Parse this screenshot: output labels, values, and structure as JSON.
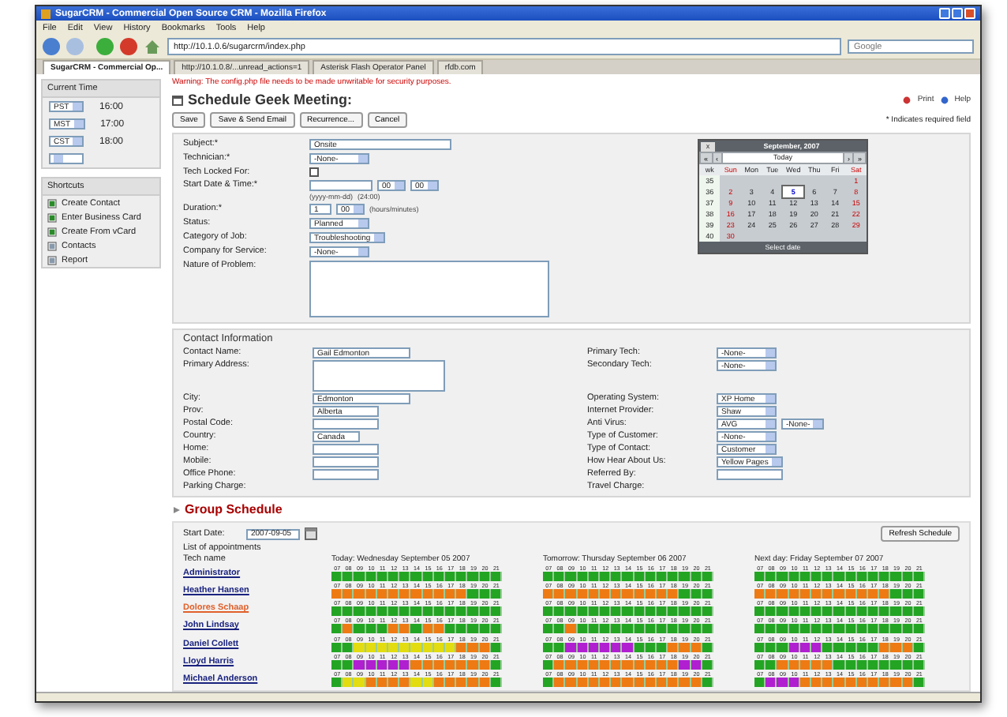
{
  "window": {
    "title": "SugarCRM - Commercial Open Source CRM - Mozilla Firefox"
  },
  "menu": [
    "File",
    "Edit",
    "View",
    "History",
    "Bookmarks",
    "Tools",
    "Help"
  ],
  "address_bar": {
    "value": "http://10.1.0.6/sugarcrm/index.php"
  },
  "search": {
    "placeholder": "Google"
  },
  "tabs": [
    {
      "label": "SugarCRM - Commercial Op...",
      "selected": true
    },
    {
      "label": "http://10.1.0.8/...unread_actions=1",
      "selected": false
    },
    {
      "label": "Asterisk Flash Operator Panel",
      "selected": false
    },
    {
      "label": "rfdb.com",
      "selected": false
    }
  ],
  "sidebar": {
    "current_time": {
      "title": "Current Time",
      "rows": [
        {
          "zone": "PST",
          "time": "16:00"
        },
        {
          "zone": "MST",
          "time": "17:00"
        },
        {
          "zone": "CST",
          "time": "18:00"
        }
      ]
    },
    "shortcuts": {
      "title": "Shortcuts",
      "items": [
        {
          "label": "Create Contact"
        },
        {
          "label": "Enter Business Card"
        },
        {
          "label": "Create From vCard"
        },
        {
          "label": "Contacts"
        },
        {
          "label": "Report"
        }
      ]
    }
  },
  "warning": "Warning: The config.php file needs to be made unwritable for security purposes.",
  "page_title": "Schedule Geek Meeting:",
  "header_links": [
    "Print",
    "Help"
  ],
  "buttons": [
    "Save",
    "Save & Send Email",
    "Recurrence...",
    "Cancel"
  ],
  "required_note": "* Indicates required field",
  "form": {
    "fields": [
      {
        "label": "Subject:*",
        "kind": "text",
        "value": "Onsite"
      },
      {
        "label": "Technician:*",
        "kind": "select",
        "value": "-None-"
      },
      {
        "label": "Tech Locked For:",
        "kind": "checkbox",
        "checked": false
      },
      {
        "label": "Start Date & Time:*",
        "kind": "datetime",
        "selects": [
          "00",
          "00"
        ],
        "hints": [
          "(yyyy-mm-dd)",
          "(24:00)"
        ]
      },
      {
        "label": "Duration:*",
        "kind": "duration",
        "value": "1",
        "selects": [
          "00"
        ],
        "hints": [
          "(hours/minutes)"
        ]
      },
      {
        "label": "Status:",
        "kind": "select",
        "value": "Planned"
      },
      {
        "label": "Category of Job:",
        "kind": "select",
        "value": "Troubleshooting"
      },
      {
        "label": "Company for Service:",
        "kind": "select",
        "value": "-None-"
      },
      {
        "label": "Nature of Problem:",
        "kind": "textarea"
      }
    ],
    "calendar": {
      "title": "September, 2007",
      "today": "Today",
      "nav": [
        "«",
        "‹",
        "›",
        "»"
      ],
      "close": "x",
      "weekdays": [
        "wk",
        "Sun",
        "Mon",
        "Tue",
        "Wed",
        "Thu",
        "Fri",
        "Sat"
      ],
      "footer": "Select date",
      "weeks": [
        {
          "week": "35",
          "days": [
            {
              "day": "1",
              "selected": false
            }
          ]
        },
        {
          "week": "36",
          "days": [
            {
              "day": "2",
              "selected": false
            },
            {
              "day": "3",
              "selected": false
            },
            {
              "day": "4",
              "selected": false
            },
            {
              "day": "5",
              "selected": true
            },
            {
              "day": "6",
              "selected": false
            },
            {
              "day": "7",
              "selected": false
            },
            {
              "day": "8",
              "selected": false
            }
          ]
        },
        {
          "week": "37",
          "days": [
            {
              "day": "9",
              "selected": false
            },
            {
              "day": "10",
              "selected": false
            },
            {
              "day": "11",
              "selected": false
            },
            {
              "day": "12",
              "selected": false
            },
            {
              "day": "13",
              "selected": false
            },
            {
              "day": "14",
              "selected": false
            },
            {
              "day": "15",
              "selected": false
            }
          ]
        },
        {
          "week": "38",
          "days": [
            {
              "day": "16",
              "selected": false
            },
            {
              "day": "17",
              "selected": false
            },
            {
              "day": "18",
              "selected": false
            },
            {
              "day": "19",
              "selected": false
            },
            {
              "day": "20",
              "selected": false
            },
            {
              "day": "21",
              "selected": false
            },
            {
              "day": "22",
              "selected": false
            }
          ]
        },
        {
          "week": "39",
          "days": [
            {
              "day": "23",
              "selected": false
            },
            {
              "day": "24",
              "selected": false
            },
            {
              "day": "25",
              "selected": false
            },
            {
              "day": "26",
              "selected": false
            },
            {
              "day": "27",
              "selected": false
            },
            {
              "day": "28",
              "selected": false
            },
            {
              "day": "29",
              "selected": false
            }
          ]
        },
        {
          "week": "40",
          "days": [
            {
              "day": "30",
              "selected": false
            }
          ]
        }
      ]
    }
  },
  "contact": {
    "title": "Contact Information",
    "left": [
      {
        "label": "Contact Name:",
        "kind": "text",
        "value": "Gail Edmonton"
      },
      {
        "label": "Primary Address:",
        "kind": "textarea"
      },
      {
        "label": "City:",
        "kind": "text",
        "value": "Edmonton"
      },
      {
        "label": "Prov:",
        "kind": "short",
        "value": "Alberta"
      },
      {
        "label": "Postal Code:",
        "kind": "short"
      },
      {
        "label": "Country:",
        "kind": "tiny",
        "value": "Canada"
      },
      {
        "label": "Home:",
        "kind": "short"
      },
      {
        "label": "Mobile:",
        "kind": "short"
      },
      {
        "label": "Office Phone:",
        "kind": "short"
      },
      {
        "label": "Parking Charge:",
        "kind": "none"
      }
    ],
    "right": [
      [
        {
          "label": "Primary Tech:",
          "kind": "select",
          "value": "-None-"
        },
        {
          "label": "Secondary Tech:",
          "kind": "select",
          "value": "-None-"
        }
      ],
      [
        {
          "label": "Operating System:",
          "kind": "select",
          "value": "XP Home"
        },
        {
          "label": "Internet Provider:",
          "kind": "select",
          "value": "Shaw"
        },
        {
          "label": "Anti Virus:",
          "kind": "select2",
          "value": "AVG",
          "value2": "-None-"
        },
        {
          "label": "Type of Customer:",
          "kind": "select",
          "value": "-None-"
        },
        {
          "label": "Type of Contact:",
          "kind": "select",
          "value": "Customer"
        },
        {
          "label": "How Hear About Us:",
          "kind": "select",
          "value": "Yellow Pages"
        },
        {
          "label": "Referred By:",
          "kind": "short"
        },
        {
          "label": "Travel Charge:",
          "kind": "none"
        }
      ]
    ]
  },
  "schedule": {
    "title": "Group Schedule",
    "start_label": "Start Date:",
    "start_value": "2007-09-05",
    "refresh": "Refresh Schedule",
    "list_label": "List of appointments",
    "tech_header": "Tech name",
    "days": [
      "Today: Wednesday September 05 2007",
      "Tomorrow: Thursday September 06 2007",
      "Next day: Friday September 07 2007"
    ],
    "rows": [
      {
        "name": "Administrator",
        "color": "#1a237e",
        "days": [
          [
            {
              "hour": "07",
              "color": "#23a523"
            },
            {
              "hour": "08",
              "color": "#23a523"
            },
            {
              "hour": "09",
              "color": "#23a523"
            },
            {
              "hour": "10",
              "color": "#23a523"
            },
            {
              "hour": "11",
              "color": "#23a523"
            },
            {
              "hour": "12",
              "color": "#23a523"
            },
            {
              "hour": "13",
              "color": "#23a523"
            },
            {
              "hour": "14",
              "color": "#23a523"
            },
            {
              "hour": "15",
              "color": "#23a523"
            },
            {
              "hour": "16",
              "color": "#23a523"
            },
            {
              "hour": "17",
              "color": "#23a523"
            },
            {
              "hour": "18",
              "color": "#23a523"
            },
            {
              "hour": "19",
              "color": "#23a523"
            },
            {
              "hour": "20",
              "color": "#23a523"
            },
            {
              "hour": "21",
              "color": "#23a523"
            }
          ],
          [
            {
              "hour": "07",
              "color": "#23a523"
            },
            {
              "hour": "08",
              "color": "#23a523"
            },
            {
              "hour": "09",
              "color": "#23a523"
            },
            {
              "hour": "10",
              "color": "#23a523"
            },
            {
              "hour": "11",
              "color": "#23a523"
            },
            {
              "hour": "12",
              "color": "#23a523"
            },
            {
              "hour": "13",
              "color": "#23a523"
            },
            {
              "hour": "14",
              "color": "#23a523"
            },
            {
              "hour": "15",
              "color": "#23a523"
            },
            {
              "hour": "16",
              "color": "#23a523"
            },
            {
              "hour": "17",
              "color": "#23a523"
            },
            {
              "hour": "18",
              "color": "#23a523"
            },
            {
              "hour": "19",
              "color": "#23a523"
            },
            {
              "hour": "20",
              "color": "#23a523"
            },
            {
              "hour": "21",
              "color": "#23a523"
            }
          ],
          [
            {
              "hour": "07",
              "color": "#23a523"
            },
            {
              "hour": "08",
              "color": "#23a523"
            },
            {
              "hour": "09",
              "color": "#23a523"
            },
            {
              "hour": "10",
              "color": "#23a523"
            },
            {
              "hour": "11",
              "color": "#23a523"
            },
            {
              "hour": "12",
              "color": "#23a523"
            },
            {
              "hour": "13",
              "color": "#23a523"
            },
            {
              "hour": "14",
              "color": "#23a523"
            },
            {
              "hour": "15",
              "color": "#23a523"
            },
            {
              "hour": "16",
              "color": "#23a523"
            },
            {
              "hour": "17",
              "color": "#23a523"
            },
            {
              "hour": "18",
              "color": "#23a523"
            },
            {
              "hour": "19",
              "color": "#23a523"
            },
            {
              "hour": "20",
              "color": "#23a523"
            },
            {
              "hour": "21",
              "color": "#23a523"
            }
          ]
        ]
      },
      {
        "name": "Heather Hansen",
        "color": "#1a237e",
        "days": [
          [
            {
              "hour": "07",
              "color": "#ee7a14"
            },
            {
              "hour": "08",
              "color": "#ee7a14"
            },
            {
              "hour": "09",
              "color": "#ee7a14"
            },
            {
              "hour": "10",
              "color": "#ee7a14"
            },
            {
              "hour": "11",
              "color": "#ee7a14"
            },
            {
              "hour": "12",
              "color": "#ee7a14"
            },
            {
              "hour": "13",
              "color": "#ee7a14"
            },
            {
              "hour": "14",
              "color": "#ee7a14"
            },
            {
              "hour": "15",
              "color": "#ee7a14"
            },
            {
              "hour": "16",
              "color": "#ee7a14"
            },
            {
              "hour": "17",
              "color": "#ee7a14"
            },
            {
              "hour": "18",
              "color": "#ee7a14"
            },
            {
              "hour": "19",
              "color": "#23a523"
            },
            {
              "hour": "20",
              "color": "#23a523"
            },
            {
              "hour": "21",
              "color": "#23a523"
            }
          ],
          [
            {
              "hour": "07",
              "color": "#ee7a14"
            },
            {
              "hour": "08",
              "color": "#ee7a14"
            },
            {
              "hour": "09",
              "color": "#ee7a14"
            },
            {
              "hour": "10",
              "color": "#ee7a14"
            },
            {
              "hour": "11",
              "color": "#ee7a14"
            },
            {
              "hour": "12",
              "color": "#ee7a14"
            },
            {
              "hour": "13",
              "color": "#ee7a14"
            },
            {
              "hour": "14",
              "color": "#ee7a14"
            },
            {
              "hour": "15",
              "color": "#ee7a14"
            },
            {
              "hour": "16",
              "color": "#ee7a14"
            },
            {
              "hour": "17",
              "color": "#ee7a14"
            },
            {
              "hour": "18",
              "color": "#ee7a14"
            },
            {
              "hour": "19",
              "color": "#23a523"
            },
            {
              "hour": "20",
              "color": "#23a523"
            },
            {
              "hour": "21",
              "color": "#23a523"
            }
          ],
          [
            {
              "hour": "07",
              "color": "#ee7a14"
            },
            {
              "hour": "08",
              "color": "#ee7a14"
            },
            {
              "hour": "09",
              "color": "#ee7a14"
            },
            {
              "hour": "10",
              "color": "#ee7a14"
            },
            {
              "hour": "11",
              "color": "#ee7a14"
            },
            {
              "hour": "12",
              "color": "#ee7a14"
            },
            {
              "hour": "13",
              "color": "#ee7a14"
            },
            {
              "hour": "14",
              "color": "#ee7a14"
            },
            {
              "hour": "15",
              "color": "#ee7a14"
            },
            {
              "hour": "16",
              "color": "#ee7a14"
            },
            {
              "hour": "17",
              "color": "#ee7a14"
            },
            {
              "hour": "18",
              "color": "#ee7a14"
            },
            {
              "hour": "19",
              "color": "#23a523"
            },
            {
              "hour": "20",
              "color": "#23a523"
            },
            {
              "hour": "21",
              "color": "#23a523"
            }
          ]
        ]
      },
      {
        "name": "Dolores Schaap",
        "color": "#e0602a",
        "days": [
          [
            {
              "hour": "07",
              "color": "#23a523"
            },
            {
              "hour": "08",
              "color": "#23a523"
            },
            {
              "hour": "09",
              "color": "#23a523"
            },
            {
              "hour": "10",
              "color": "#23a523"
            },
            {
              "hour": "11",
              "color": "#23a523"
            },
            {
              "hour": "12",
              "color": "#23a523"
            },
            {
              "hour": "13",
              "color": "#23a523"
            },
            {
              "hour": "14",
              "color": "#23a523"
            },
            {
              "hour": "15",
              "color": "#23a523"
            },
            {
              "hour": "16",
              "color": "#23a523"
            },
            {
              "hour": "17",
              "color": "#23a523"
            },
            {
              "hour": "18",
              "color": "#23a523"
            },
            {
              "hour": "19",
              "color": "#23a523"
            },
            {
              "hour": "20",
              "color": "#23a523"
            },
            {
              "hour": "21",
              "color": "#23a523"
            }
          ],
          [
            {
              "hour": "07",
              "color": "#23a523"
            },
            {
              "hour": "08",
              "color": "#23a523"
            },
            {
              "hour": "09",
              "color": "#23a523"
            },
            {
              "hour": "10",
              "color": "#23a523"
            },
            {
              "hour": "11",
              "color": "#23a523"
            },
            {
              "hour": "12",
              "color": "#23a523"
            },
            {
              "hour": "13",
              "color": "#23a523"
            },
            {
              "hour": "14",
              "color": "#23a523"
            },
            {
              "hour": "15",
              "color": "#23a523"
            },
            {
              "hour": "16",
              "color": "#23a523"
            },
            {
              "hour": "17",
              "color": "#23a523"
            },
            {
              "hour": "18",
              "color": "#23a523"
            },
            {
              "hour": "19",
              "color": "#23a523"
            },
            {
              "hour": "20",
              "color": "#23a523"
            },
            {
              "hour": "21",
              "color": "#23a523"
            }
          ],
          [
            {
              "hour": "07",
              "color": "#23a523"
            },
            {
              "hour": "08",
              "color": "#23a523"
            },
            {
              "hour": "09",
              "color": "#23a523"
            },
            {
              "hour": "10",
              "color": "#23a523"
            },
            {
              "hour": "11",
              "color": "#23a523"
            },
            {
              "hour": "12",
              "color": "#23a523"
            },
            {
              "hour": "13",
              "color": "#23a523"
            },
            {
              "hour": "14",
              "color": "#23a523"
            },
            {
              "hour": "15",
              "color": "#23a523"
            },
            {
              "hour": "16",
              "color": "#23a523"
            },
            {
              "hour": "17",
              "color": "#23a523"
            },
            {
              "hour": "18",
              "color": "#23a523"
            },
            {
              "hour": "19",
              "color": "#23a523"
            },
            {
              "hour": "20",
              "color": "#23a523"
            },
            {
              "hour": "21",
              "color": "#23a523"
            }
          ]
        ]
      },
      {
        "name": "John Lindsay",
        "color": "#1a237e",
        "days": [
          [
            {
              "hour": "07",
              "color": "#23a523"
            },
            {
              "hour": "08",
              "color": "#ee7a14"
            },
            {
              "hour": "09",
              "color": "#23a523"
            },
            {
              "hour": "10",
              "color": "#23a523"
            },
            {
              "hour": "11",
              "color": "#23a523"
            },
            {
              "hour": "12",
              "color": "#ee7a14"
            },
            {
              "hour": "13",
              "color": "#ee7a14"
            },
            {
              "hour": "14",
              "color": "#23a523"
            },
            {
              "hour": "15",
              "color": "#ee7a14"
            },
            {
              "hour": "16",
              "color": "#ee7a14"
            },
            {
              "hour": "17",
              "color": "#23a523"
            },
            {
              "hour": "18",
              "color": "#23a523"
            },
            {
              "hour": "19",
              "color": "#23a523"
            },
            {
              "hour": "20",
              "color": "#23a523"
            },
            {
              "hour": "21",
              "color": "#23a523"
            }
          ],
          [
            {
              "hour": "07",
              "color": "#23a523"
            },
            {
              "hour": "08",
              "color": "#23a523"
            },
            {
              "hour": "09",
              "color": "#ee7a14"
            },
            {
              "hour": "10",
              "color": "#23a523"
            },
            {
              "hour": "11",
              "color": "#23a523"
            },
            {
              "hour": "12",
              "color": "#23a523"
            },
            {
              "hour": "13",
              "color": "#23a523"
            },
            {
              "hour": "14",
              "color": "#23a523"
            },
            {
              "hour": "15",
              "color": "#23a523"
            },
            {
              "hour": "16",
              "color": "#23a523"
            },
            {
              "hour": "17",
              "color": "#23a523"
            },
            {
              "hour": "18",
              "color": "#23a523"
            },
            {
              "hour": "19",
              "color": "#23a523"
            },
            {
              "hour": "20",
              "color": "#23a523"
            },
            {
              "hour": "21",
              "color": "#23a523"
            }
          ],
          [
            {
              "hour": "07",
              "color": "#23a523"
            },
            {
              "hour": "08",
              "color": "#23a523"
            },
            {
              "hour": "09",
              "color": "#23a523"
            },
            {
              "hour": "10",
              "color": "#23a523"
            },
            {
              "hour": "11",
              "color": "#23a523"
            },
            {
              "hour": "12",
              "color": "#23a523"
            },
            {
              "hour": "13",
              "color": "#23a523"
            },
            {
              "hour": "14",
              "color": "#23a523"
            },
            {
              "hour": "15",
              "color": "#23a523"
            },
            {
              "hour": "16",
              "color": "#23a523"
            },
            {
              "hour": "17",
              "color": "#23a523"
            },
            {
              "hour": "18",
              "color": "#23a523"
            },
            {
              "hour": "19",
              "color": "#23a523"
            },
            {
              "hour": "20",
              "color": "#23a523"
            },
            {
              "hour": "21",
              "color": "#23a523"
            }
          ]
        ]
      },
      {
        "name": "Daniel Collett",
        "color": "#1a237e",
        "days": [
          [
            {
              "hour": "07",
              "color": "#23a523"
            },
            {
              "hour": "08",
              "color": "#23a523"
            },
            {
              "hour": "09",
              "color": "#e2dc10"
            },
            {
              "hour": "10",
              "color": "#e2dc10"
            },
            {
              "hour": "11",
              "color": "#e2dc10"
            },
            {
              "hour": "12",
              "color": "#e2dc10"
            },
            {
              "hour": "13",
              "color": "#e2dc10"
            },
            {
              "hour": "14",
              "color": "#e2dc10"
            },
            {
              "hour": "15",
              "color": "#e2dc10"
            },
            {
              "hour": "16",
              "color": "#e2dc10"
            },
            {
              "hour": "17",
              "color": "#e2dc10"
            },
            {
              "hour": "18",
              "color": "#ee7a14"
            },
            {
              "hour": "19",
              "color": "#ee7a14"
            },
            {
              "hour": "20",
              "color": "#ee7a14"
            },
            {
              "hour": "21",
              "color": "#23a523"
            }
          ],
          [
            {
              "hour": "07",
              "color": "#23a523"
            },
            {
              "hour": "08",
              "color": "#23a523"
            },
            {
              "hour": "09",
              "color": "#b020d0"
            },
            {
              "hour": "10",
              "color": "#b020d0"
            },
            {
              "hour": "11",
              "color": "#b020d0"
            },
            {
              "hour": "12",
              "color": "#b020d0"
            },
            {
              "hour": "13",
              "color": "#b020d0"
            },
            {
              "hour": "14",
              "color": "#b020d0"
            },
            {
              "hour": "15",
              "color": "#23a523"
            },
            {
              "hour": "16",
              "color": "#23a523"
            },
            {
              "hour": "17",
              "color": "#23a523"
            },
            {
              "hour": "18",
              "color": "#ee7a14"
            },
            {
              "hour": "19",
              "color": "#ee7a14"
            },
            {
              "hour": "20",
              "color": "#ee7a14"
            },
            {
              "hour": "21",
              "color": "#23a523"
            }
          ],
          [
            {
              "hour": "07",
              "color": "#23a523"
            },
            {
              "hour": "08",
              "color": "#23a523"
            },
            {
              "hour": "09",
              "color": "#23a523"
            },
            {
              "hour": "10",
              "color": "#b020d0"
            },
            {
              "hour": "11",
              "color": "#b020d0"
            },
            {
              "hour": "12",
              "color": "#b020d0"
            },
            {
              "hour": "13",
              "color": "#23a523"
            },
            {
              "hour": "14",
              "color": "#23a523"
            },
            {
              "hour": "15",
              "color": "#23a523"
            },
            {
              "hour": "16",
              "color": "#23a523"
            },
            {
              "hour": "17",
              "color": "#23a523"
            },
            {
              "hour": "18",
              "color": "#ee7a14"
            },
            {
              "hour": "19",
              "color": "#ee7a14"
            },
            {
              "hour": "20",
              "color": "#ee7a14"
            },
            {
              "hour": "21",
              "color": "#23a523"
            }
          ]
        ]
      },
      {
        "name": "Lloyd Harris",
        "color": "#1a237e",
        "days": [
          [
            {
              "hour": "07",
              "color": "#23a523"
            },
            {
              "hour": "08",
              "color": "#23a523"
            },
            {
              "hour": "09",
              "color": "#b020d0"
            },
            {
              "hour": "10",
              "color": "#b020d0"
            },
            {
              "hour": "11",
              "color": "#b020d0"
            },
            {
              "hour": "12",
              "color": "#b020d0"
            },
            {
              "hour": "13",
              "color": "#b020d0"
            },
            {
              "hour": "14",
              "color": "#ee7a14"
            },
            {
              "hour": "15",
              "color": "#ee7a14"
            },
            {
              "hour": "16",
              "color": "#ee7a14"
            },
            {
              "hour": "17",
              "color": "#ee7a14"
            },
            {
              "hour": "18",
              "color": "#ee7a14"
            },
            {
              "hour": "19",
              "color": "#ee7a14"
            },
            {
              "hour": "20",
              "color": "#ee7a14"
            },
            {
              "hour": "21",
              "color": "#23a523"
            }
          ],
          [
            {
              "hour": "07",
              "color": "#23a523"
            },
            {
              "hour": "08",
              "color": "#ee7a14"
            },
            {
              "hour": "09",
              "color": "#ee7a14"
            },
            {
              "hour": "10",
              "color": "#ee7a14"
            },
            {
              "hour": "11",
              "color": "#ee7a14"
            },
            {
              "hour": "12",
              "color": "#ee7a14"
            },
            {
              "hour": "13",
              "color": "#ee7a14"
            },
            {
              "hour": "14",
              "color": "#ee7a14"
            },
            {
              "hour": "15",
              "color": "#ee7a14"
            },
            {
              "hour": "16",
              "color": "#ee7a14"
            },
            {
              "hour": "17",
              "color": "#ee7a14"
            },
            {
              "hour": "18",
              "color": "#ee7a14"
            },
            {
              "hour": "19",
              "color": "#b020d0"
            },
            {
              "hour": "20",
              "color": "#b020d0"
            },
            {
              "hour": "21",
              "color": "#23a523"
            }
          ],
          [
            {
              "hour": "07",
              "color": "#23a523"
            },
            {
              "hour": "08",
              "color": "#23a523"
            },
            {
              "hour": "09",
              "color": "#ee7a14"
            },
            {
              "hour": "10",
              "color": "#ee7a14"
            },
            {
              "hour": "11",
              "color": "#ee7a14"
            },
            {
              "hour": "12",
              "color": "#ee7a14"
            },
            {
              "hour": "13",
              "color": "#ee7a14"
            },
            {
              "hour": "14",
              "color": "#23a523"
            },
            {
              "hour": "15",
              "color": "#23a523"
            },
            {
              "hour": "16",
              "color": "#23a523"
            },
            {
              "hour": "17",
              "color": "#23a523"
            },
            {
              "hour": "18",
              "color": "#23a523"
            },
            {
              "hour": "19",
              "color": "#23a523"
            },
            {
              "hour": "20",
              "color": "#23a523"
            },
            {
              "hour": "21",
              "color": "#23a523"
            }
          ]
        ]
      },
      {
        "name": "Michael Anderson",
        "color": "#1a237e",
        "days": [
          [
            {
              "hour": "07",
              "color": "#23a523"
            },
            {
              "hour": "08",
              "color": "#e2dc10"
            },
            {
              "hour": "09",
              "color": "#e2dc10"
            },
            {
              "hour": "10",
              "color": "#ee7a14"
            },
            {
              "hour": "11",
              "color": "#ee7a14"
            },
            {
              "hour": "12",
              "color": "#ee7a14"
            },
            {
              "hour": "13",
              "color": "#ee7a14"
            },
            {
              "hour": "14",
              "color": "#e2dc10"
            },
            {
              "hour": "15",
              "color": "#e2dc10"
            },
            {
              "hour": "16",
              "color": "#ee7a14"
            },
            {
              "hour": "17",
              "color": "#ee7a14"
            },
            {
              "hour": "18",
              "color": "#ee7a14"
            },
            {
              "hour": "19",
              "color": "#ee7a14"
            },
            {
              "hour": "20",
              "color": "#ee7a14"
            },
            {
              "hour": "21",
              "color": "#23a523"
            }
          ],
          [
            {
              "hour": "07",
              "color": "#23a523"
            },
            {
              "hour": "08",
              "color": "#ee7a14"
            },
            {
              "hour": "09",
              "color": "#ee7a14"
            },
            {
              "hour": "10",
              "color": "#ee7a14"
            },
            {
              "hour": "11",
              "color": "#ee7a14"
            },
            {
              "hour": "12",
              "color": "#ee7a14"
            },
            {
              "hour": "13",
              "color": "#ee7a14"
            },
            {
              "hour": "14",
              "color": "#ee7a14"
            },
            {
              "hour": "15",
              "color": "#ee7a14"
            },
            {
              "hour": "16",
              "color": "#ee7a14"
            },
            {
              "hour": "17",
              "color": "#ee7a14"
            },
            {
              "hour": "18",
              "color": "#ee7a14"
            },
            {
              "hour": "19",
              "color": "#ee7a14"
            },
            {
              "hour": "20",
              "color": "#ee7a14"
            },
            {
              "hour": "21",
              "color": "#23a523"
            }
          ],
          [
            {
              "hour": "07",
              "color": "#23a523"
            },
            {
              "hour": "08",
              "color": "#b020d0"
            },
            {
              "hour": "09",
              "color": "#b020d0"
            },
            {
              "hour": "10",
              "color": "#b020d0"
            },
            {
              "hour": "11",
              "color": "#ee7a14"
            },
            {
              "hour": "12",
              "color": "#ee7a14"
            },
            {
              "hour": "13",
              "color": "#ee7a14"
            },
            {
              "hour": "14",
              "color": "#ee7a14"
            },
            {
              "hour": "15",
              "color": "#ee7a14"
            },
            {
              "hour": "16",
              "color": "#ee7a14"
            },
            {
              "hour": "17",
              "color": "#ee7a14"
            },
            {
              "hour": "18",
              "color": "#ee7a14"
            },
            {
              "hour": "19",
              "color": "#ee7a14"
            },
            {
              "hour": "20",
              "color": "#ee7a14"
            },
            {
              "hour": "21",
              "color": "#23a523"
            }
          ]
        ]
      }
    ]
  }
}
